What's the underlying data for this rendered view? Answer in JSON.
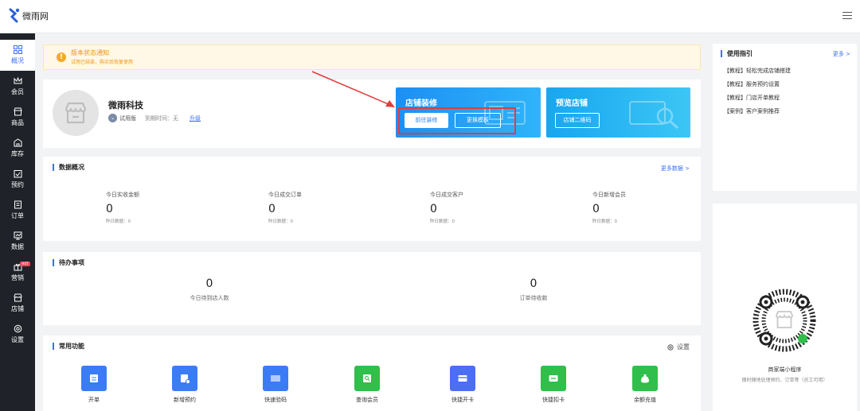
{
  "brand": {
    "name": "微雨网"
  },
  "sidebar": {
    "items": [
      {
        "label": "概况",
        "icon": "grid-icon",
        "active": true
      },
      {
        "label": "会员",
        "icon": "crown-icon"
      },
      {
        "label": "商品",
        "icon": "shop-icon"
      },
      {
        "label": "库存",
        "icon": "warehouse-icon"
      },
      {
        "label": "预约",
        "icon": "calendar-check-icon"
      },
      {
        "label": "订单",
        "icon": "order-icon"
      },
      {
        "label": "数据",
        "icon": "chart-icon"
      },
      {
        "label": "营销",
        "icon": "gift-icon",
        "badge": "HOT"
      },
      {
        "label": "店铺",
        "icon": "store-icon"
      },
      {
        "label": "设置",
        "icon": "gear-icon"
      }
    ]
  },
  "notice": {
    "title": "版本状态通知",
    "desc": "试用已结束，购买后恢复使用"
  },
  "shop": {
    "name": "微雨科技",
    "plan": "试用版",
    "expire_label": "到期时间：无",
    "upgrade": "升级"
  },
  "decoration": {
    "title": "店铺装修",
    "btn_go": "前往装修",
    "btn_template": "更换模板"
  },
  "preview": {
    "title": "预览店铺",
    "btn_qr": "店铺二维码"
  },
  "data_overview": {
    "title": "数据概况",
    "more": "更多数据 >",
    "stats": [
      {
        "label": "今日实收金额",
        "value": "0",
        "sub": "昨日数据：0"
      },
      {
        "label": "今日成交订单",
        "value": "0",
        "sub": "昨日数据：0"
      },
      {
        "label": "今日成交客户",
        "value": "0",
        "sub": "昨日数据：0"
      },
      {
        "label": "今日新增会员",
        "value": "0",
        "sub": "昨日数据：0"
      }
    ]
  },
  "todo": {
    "title": "待办事项",
    "items": [
      {
        "value": "0",
        "label": "今日待到店人数"
      },
      {
        "value": "0",
        "label": "订单待收款"
      }
    ]
  },
  "common": {
    "title": "常用功能",
    "settings": "设置",
    "items": [
      {
        "label": "开单",
        "color": "#3b7cf6"
      },
      {
        "label": "新增预约",
        "color": "#3b7cf6"
      },
      {
        "label": "快速验码",
        "color": "#3b7cf6"
      },
      {
        "label": "查询会员",
        "color": "#2fbf4a"
      },
      {
        "label": "快捷开卡",
        "color": "#4c6ef5"
      },
      {
        "label": "快捷扣卡",
        "color": "#2fbf4a"
      },
      {
        "label": "余额充值",
        "color": "#2fbf4a"
      }
    ]
  },
  "guide": {
    "title": "使用指引",
    "more": "更多 >",
    "links": [
      "【教程】轻松完成店铺搭建",
      "【教程】服务预约设置",
      "【教程】门店开单教程",
      "【案例】客户案例推荐"
    ]
  },
  "mini_program": {
    "title": "商家端小程序",
    "desc": "随时随地处理预约、订单等（员工可用）"
  },
  "colors": {
    "accent": "#3b6ff6",
    "sidebar_bg": "#1f2329",
    "highlight": "#e63b3b"
  }
}
